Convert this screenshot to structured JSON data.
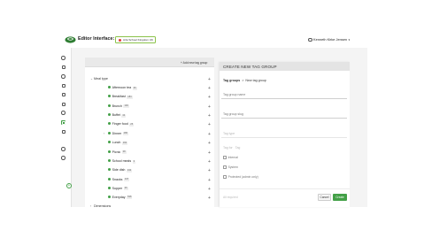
{
  "header": {
    "app_title": "Editor Interface:",
    "site_label": "Arla School Kingdom UK",
    "user_name": "Kenneth Kirke Jensen",
    "logo_icon": "arla-logo",
    "accent_color": "#43a047"
  },
  "rail": {
    "icons": [
      "home-icon",
      "folder-icon",
      "bulb-icon",
      "image-icon",
      "document-icon",
      "basket-icon",
      "search-icon",
      "tags-icon",
      "card-icon",
      "settings-icon",
      "help-icon",
      "add-icon"
    ],
    "active_icon": "tags-icon"
  },
  "list": {
    "add_group_label": "+ Add new tag group",
    "group_label": "Meal type",
    "partial_group_label": "Dimensions",
    "items": [
      {
        "label": "Afternoon tea",
        "count": "36"
      },
      {
        "label": "Breakfast",
        "count": "184"
      },
      {
        "label": "Brunch",
        "count": "100"
      },
      {
        "label": "Buffet",
        "count": "44"
      },
      {
        "label": "Finger food",
        "count": "25"
      },
      {
        "label": "Dinner",
        "count": "286"
      },
      {
        "label": "Lunch",
        "count": "360"
      },
      {
        "label": "Picnic",
        "count": "38"
      },
      {
        "label": "School meals",
        "count": "3"
      },
      {
        "label": "Side dish",
        "count": "342"
      },
      {
        "label": "Snacks",
        "count": "347"
      },
      {
        "label": "Supper",
        "count": "36"
      },
      {
        "label": "Everyday",
        "count": "538"
      }
    ]
  },
  "create": {
    "title": "CREATE NEW TAG GROUP",
    "breadcrumb_root": "Tag groups",
    "breadcrumb_sep": ">",
    "breadcrumb_current": "New tag group",
    "name_label": "Tag group name",
    "slug_label": "Tag group slug",
    "tag_type_label": "Tag type",
    "tag_for_label": "Tag for",
    "tag_for_value": "Tag",
    "checkbox_internal": "Internal",
    "checkbox_system": "System",
    "checkbox_protected": "Protected (admin only)",
    "footer_hint": "All required",
    "cancel_label": "Cancel",
    "create_label": "Create"
  }
}
